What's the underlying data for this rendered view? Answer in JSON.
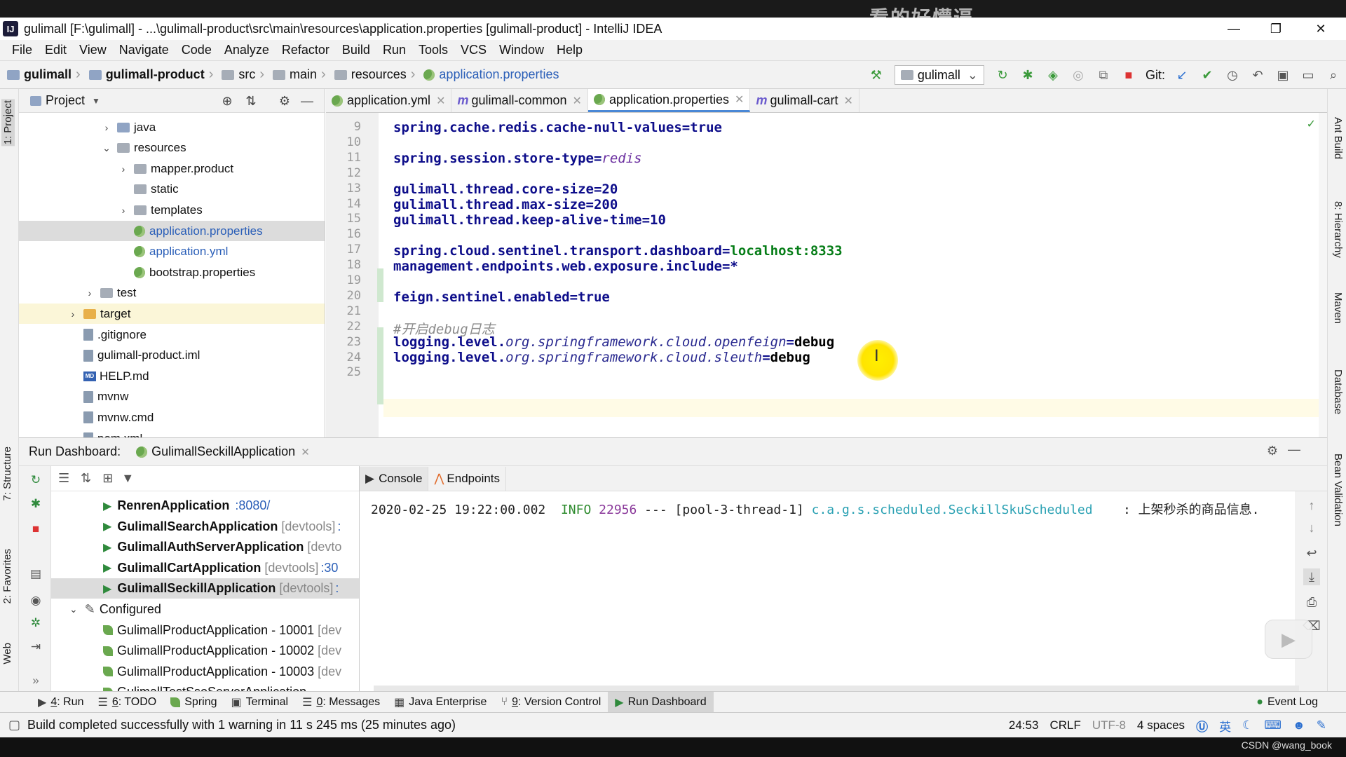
{
  "window": {
    "title": "gulimall [F:\\gulimall] - ...\\gulimall-product\\src\\main\\resources\\application.properties [gulimall-product] - IntelliJ IDEA",
    "minimize": "—",
    "maximize": "❐",
    "close": "✕",
    "watermark": "看的好懵逼"
  },
  "menu": [
    "File",
    "Edit",
    "View",
    "Navigate",
    "Code",
    "Analyze",
    "Refactor",
    "Build",
    "Run",
    "Tools",
    "VCS",
    "Window",
    "Help"
  ],
  "breadcrumbs": [
    "gulimall",
    "gulimall-product",
    "src",
    "main",
    "resources",
    "application.properties"
  ],
  "toolbar": {
    "run_config": "gulimall",
    "git_label": "Git:"
  },
  "project": {
    "header": "Project",
    "tree": [
      {
        "label": "java",
        "arrow": "›",
        "kind": "folder"
      },
      {
        "label": "resources",
        "arrow": "⌄",
        "kind": "folder-gray"
      },
      {
        "label": "mapper.product",
        "arrow": "›",
        "kind": "folder-gray"
      },
      {
        "label": "static",
        "arrow": "",
        "kind": "folder-gray"
      },
      {
        "label": "templates",
        "arrow": "›",
        "kind": "folder-gray"
      },
      {
        "label": "application.properties",
        "arrow": "",
        "kind": "prop"
      },
      {
        "label": "application.yml",
        "arrow": "",
        "kind": "prop"
      },
      {
        "label": "bootstrap.properties",
        "arrow": "",
        "kind": "prop"
      },
      {
        "label": "test",
        "arrow": "›",
        "kind": "folder-gray"
      },
      {
        "label": "target",
        "arrow": "›",
        "kind": "folder-yellow"
      },
      {
        "label": ".gitignore",
        "arrow": "",
        "kind": "file"
      },
      {
        "label": "gulimall-product.iml",
        "arrow": "",
        "kind": "file"
      },
      {
        "label": "HELP.md",
        "arrow": "",
        "kind": "md"
      },
      {
        "label": "mvnw",
        "arrow": "",
        "kind": "file"
      },
      {
        "label": "mvnw.cmd",
        "arrow": "",
        "kind": "file"
      },
      {
        "label": "pom.xml",
        "arrow": "",
        "kind": "file"
      }
    ]
  },
  "tabs": [
    {
      "label": "application.yml",
      "icon": "prop"
    },
    {
      "label": "gulimall-common",
      "icon": "m"
    },
    {
      "label": "application.properties",
      "icon": "prop"
    },
    {
      "label": "gulimall-cart",
      "icon": "m"
    }
  ],
  "editor": {
    "line_numbers": [
      "9",
      "10",
      "11",
      "12",
      "13",
      "14",
      "15",
      "16",
      "17",
      "18",
      "19",
      "20",
      "21",
      "22",
      "23",
      "24",
      "25"
    ],
    "lines": {
      "l9": "spring.cache.redis.cache-null-values=true",
      "l11a": "spring.session.store-type=",
      "l11b": "redis",
      "l13": "gulimall.thread.core-size=20",
      "l14": "gulimall.thread.max-size=200",
      "l15": "gulimall.thread.keep-alive-time=10",
      "l17a": "spring.cloud.sentinel.transport.dashboard=",
      "l17b": "localhost:8333",
      "l18": "management.endpoints.web.exposure.include=*",
      "l20": "feign.sentinel.enabled=true",
      "l22": "#开启debug日志",
      "l23a": "logging.level.",
      "l23b": "org.springframework.cloud.openfeign",
      "l23c": "=",
      "l23d": "debug",
      "l24a": "logging.level.",
      "l24b": "org.springframework.cloud.sleuth",
      "l24c": "=",
      "l24d": "debug"
    },
    "cursor_glyph": "I"
  },
  "run_dashboard": {
    "title": "Run Dashboard:",
    "app_tab": "GulimallSeckillApplication",
    "apps": [
      {
        "name": "RenrenApplication",
        "extra": "",
        "port": ":8080/"
      },
      {
        "name": "GulimallSearchApplication",
        "extra": "[devtools]",
        "port": ":"
      },
      {
        "name": "GulimallAuthServerApplication",
        "extra": "[devto",
        "port": ""
      },
      {
        "name": "GulimallCartApplication",
        "extra": "[devtools]",
        "port": ":30"
      },
      {
        "name": "GulimallSeckillApplication",
        "extra": "[devtools]",
        "port": ":"
      }
    ],
    "configured_label": "Configured",
    "configured": [
      {
        "name": "GulimallProductApplication - 10001",
        "extra": "[dev"
      },
      {
        "name": "GulimallProductApplication - 10002",
        "extra": "[dev"
      },
      {
        "name": "GulimallProductApplication - 10003",
        "extra": "[dev"
      },
      {
        "name": "GulimallTestSsoServerApplication",
        "extra": ""
      }
    ],
    "console_tab": "Console",
    "endpoints_tab": "Endpoints",
    "log": {
      "timestamp": "2020-02-25 19:22:00.002",
      "level": "INFO",
      "pid": "22956",
      "sep": "---",
      "thread": "[pool-3-thread-1]",
      "logger": "c.a.g.s.scheduled.SeckillSkuScheduled",
      "message": ": 上架秒杀的商品信息."
    }
  },
  "left_tabs": [
    "1: Project",
    "7: Structure",
    "2: Favorites",
    "Web"
  ],
  "right_tabs": [
    "Ant Build",
    "8: Hierarchy",
    "Maven",
    "Database",
    "Bean Validation"
  ],
  "tool_windows": [
    {
      "num": "4",
      "label": ": Run"
    },
    {
      "num": "6",
      "label": ": TODO"
    },
    {
      "num": "",
      "label": "Spring"
    },
    {
      "num": "",
      "label": "Terminal"
    },
    {
      "num": "0",
      "label": ": Messages"
    },
    {
      "num": "",
      "label": "Java Enterprise"
    },
    {
      "num": "9",
      "label": ": Version Control"
    },
    {
      "num": "",
      "label": "Run Dashboard"
    }
  ],
  "event_log": "Event Log",
  "status": {
    "message": "Build completed successfully with 1 warning in 11 s 245 ms (25 minutes ago)",
    "position": "24:53",
    "line_sep": "CRLF",
    "encoding": "UTF-8",
    "indent": "4 spaces",
    "ime": "英"
  },
  "credit": "CSDN @wang_book"
}
